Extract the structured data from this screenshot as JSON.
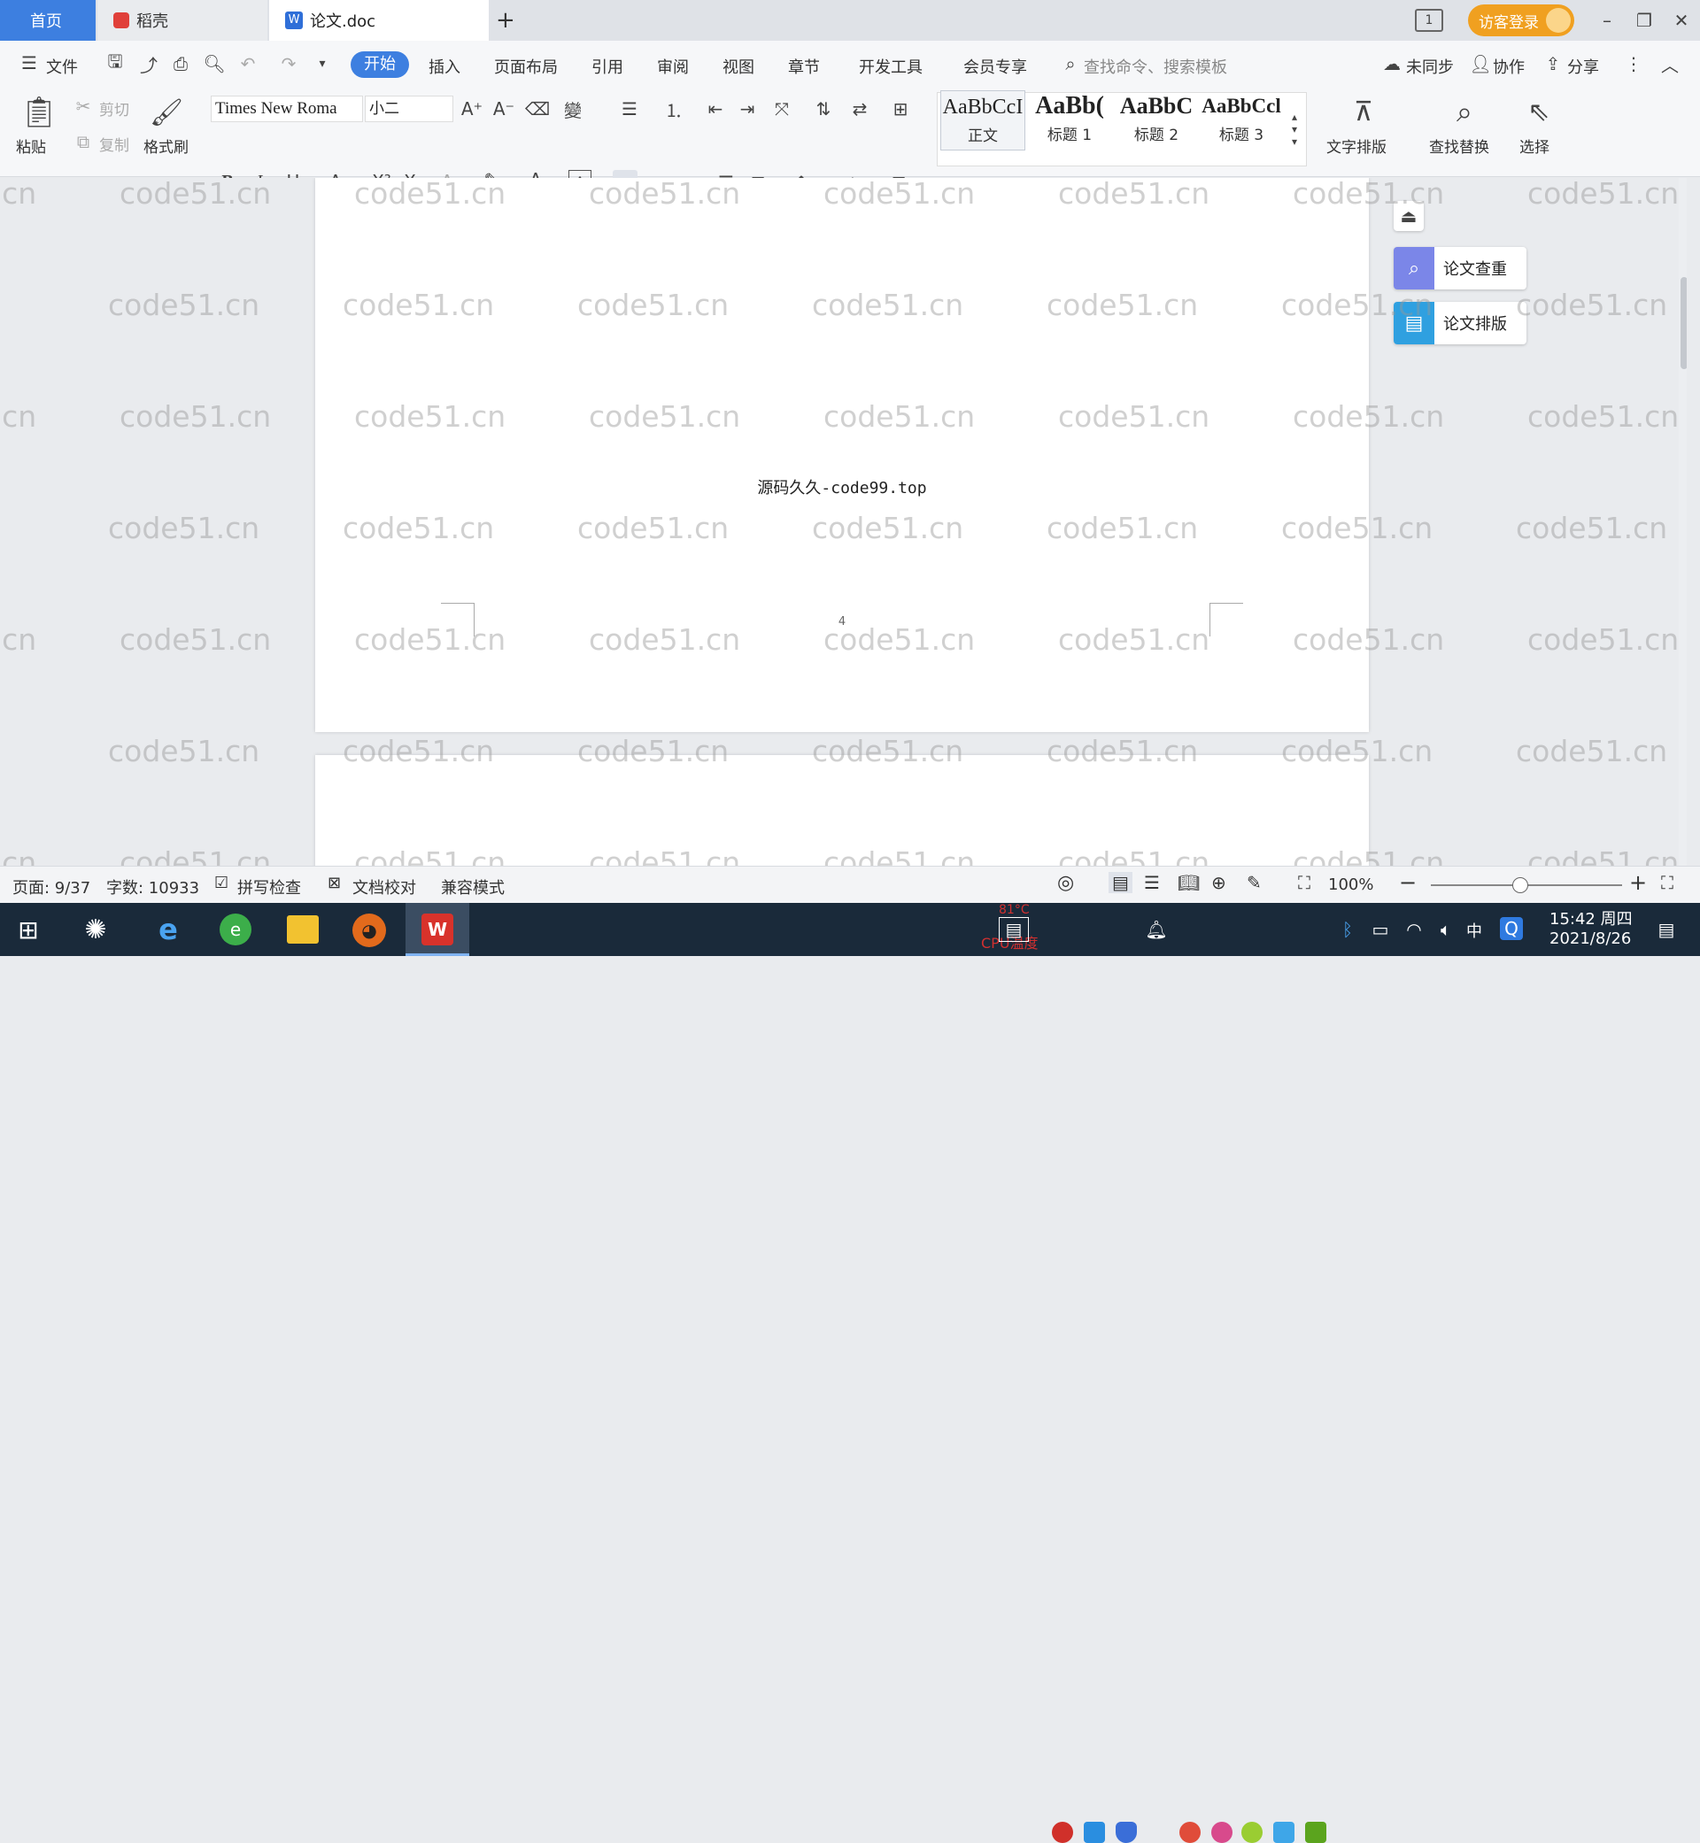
{
  "tabs": {
    "home": "首页",
    "docer": "稻壳",
    "doc": "论文.doc",
    "new_tab": "+"
  },
  "titlebar": {
    "login": "访客登录"
  },
  "menu": {
    "file": "文件",
    "items": [
      "开始",
      "插入",
      "页面布局",
      "引用",
      "审阅",
      "视图",
      "章节",
      "开发工具",
      "会员专享"
    ],
    "search": "查找命令、搜索模板",
    "sync": "未同步",
    "collab": "协作",
    "share": "分享"
  },
  "toolbar": {
    "paste": "粘贴",
    "cut": "剪切",
    "copy": "复制",
    "format_painter": "格式刷",
    "font": "Times New Roma",
    "size": "小二",
    "text_layout": "文字排版",
    "find_replace": "查找替换",
    "select": "选择"
  },
  "styles": [
    {
      "sample": "AaBbCcI",
      "name": "正文"
    },
    {
      "sample": "AaBb(",
      "name": "标题 1"
    },
    {
      "sample": "AaBbC",
      "name": "标题 2"
    },
    {
      "sample": "AaBbCcl",
      "name": "标题 3"
    }
  ],
  "side_panel": {
    "check": "论文查重",
    "format": "论文排版"
  },
  "page": {
    "text": "源码久久-code99.top",
    "page_number": "4"
  },
  "watermark": "code51.cn",
  "status": {
    "page": "页面: 9/37",
    "words": "字数: 10933",
    "spell": "拼写检查",
    "proof": "文档校对",
    "compat": "兼容模式",
    "zoom": "100%"
  },
  "taskbar": {
    "time": "15:42 周四",
    "date": "2021/8/26",
    "cpu_temp": "81°C",
    "cpu_label": "CPU温度",
    "ime": "中"
  },
  "colors": {
    "accent": "#3d7fe0",
    "login": "#f0a020",
    "taskbar": "#1a2a3a"
  }
}
